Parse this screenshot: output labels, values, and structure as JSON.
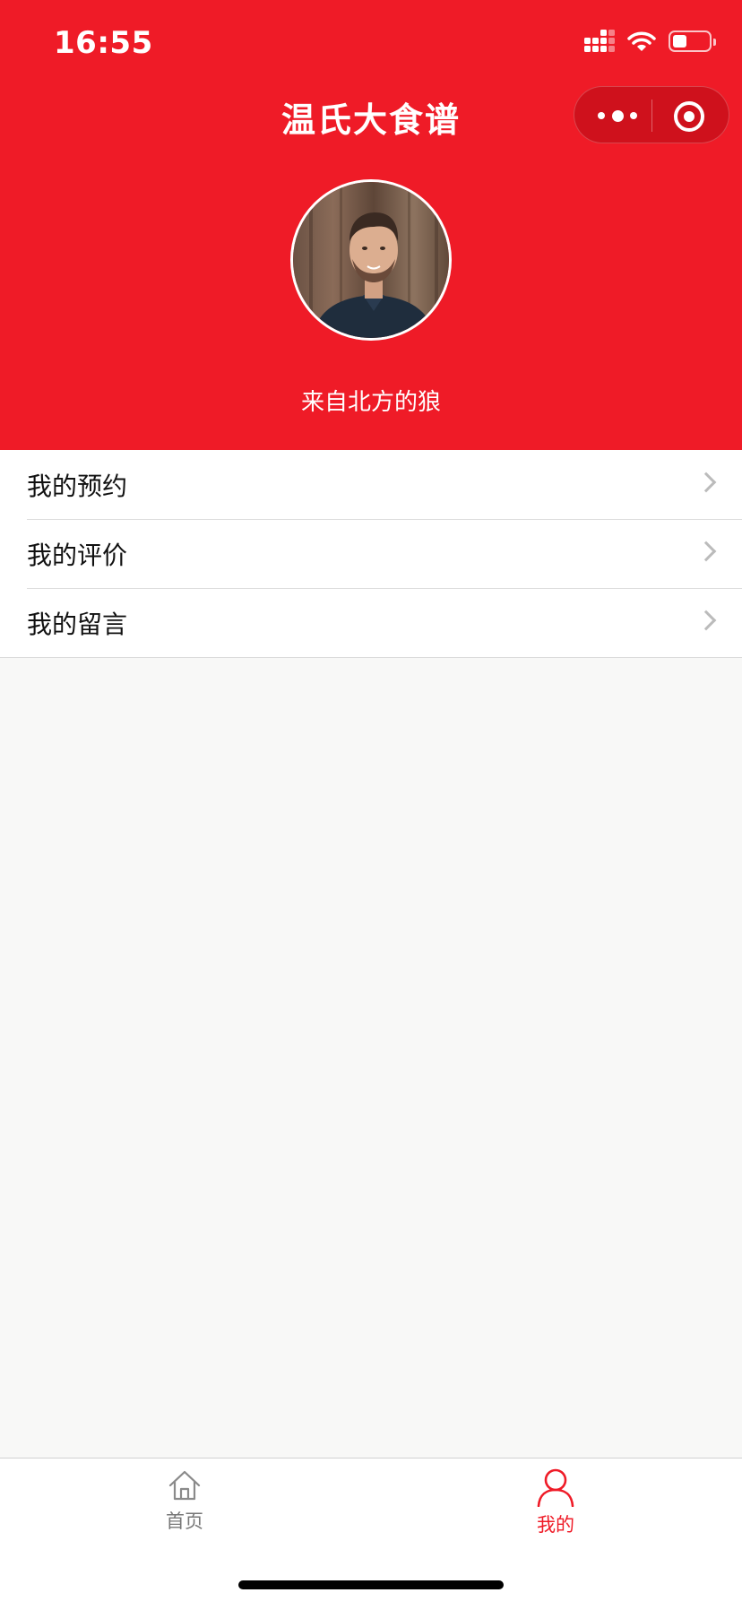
{
  "status_bar": {
    "time": "16:55"
  },
  "nav": {
    "title": "温氏大食谱"
  },
  "profile": {
    "username": "来自北方的狼"
  },
  "menu": [
    {
      "label": "我的预约"
    },
    {
      "label": "我的评价"
    },
    {
      "label": "我的留言"
    }
  ],
  "tabbar": {
    "tabs": [
      {
        "label": "首页",
        "icon": "home-icon",
        "active": false
      },
      {
        "label": "我的",
        "icon": "user-icon",
        "active": true
      }
    ]
  },
  "colors": {
    "brand": "#ef1b27",
    "background": "#f8f8f7",
    "inactive_tab": "#777777"
  }
}
